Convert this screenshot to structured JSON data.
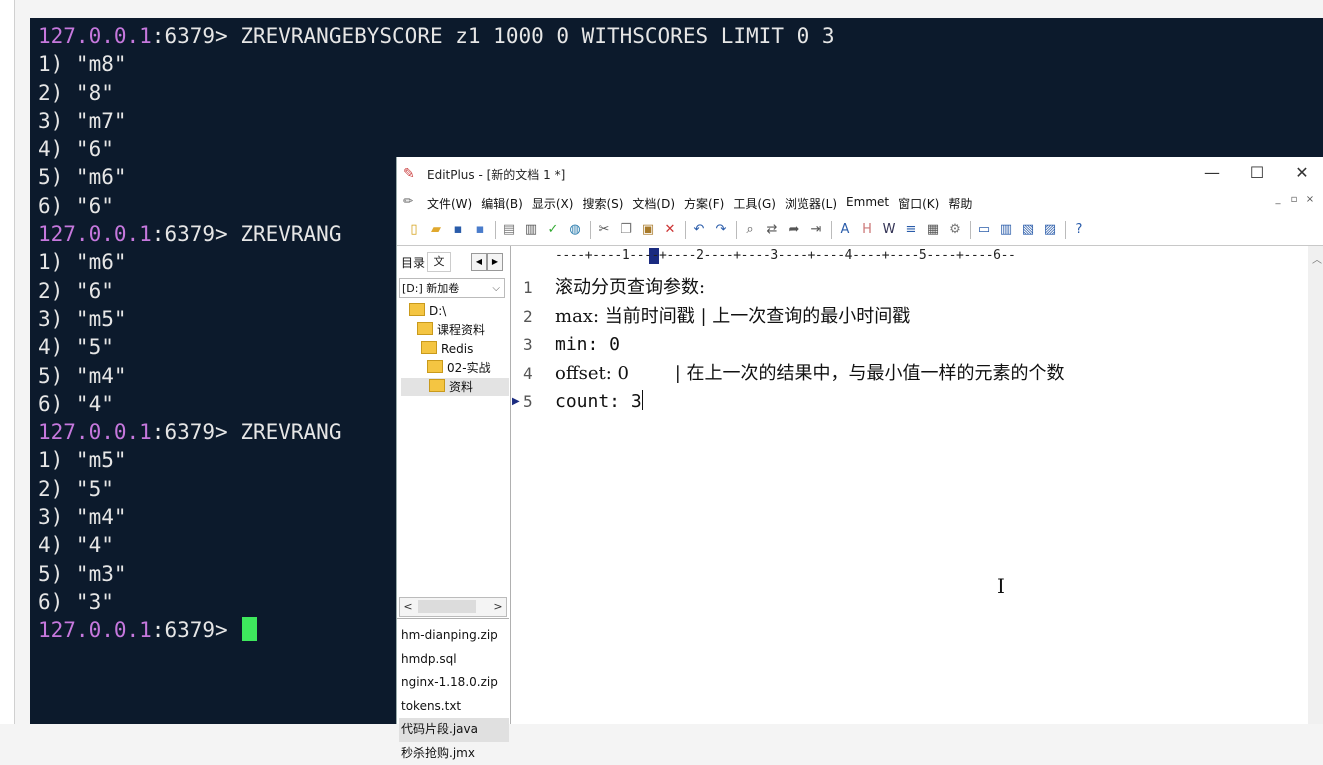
{
  "terminal": {
    "prompt_host": "127.0.0.1",
    "prompt_rest": ":6379> ",
    "lines": [
      {
        "kind": "cmd",
        "text": "ZREVRANGEBYSCORE z1 1000 0 WITHSCORES LIMIT 0 3"
      },
      {
        "kind": "out",
        "text": "1) \"m8\""
      },
      {
        "kind": "out",
        "text": "2) \"8\""
      },
      {
        "kind": "out",
        "text": "3) \"m7\""
      },
      {
        "kind": "out",
        "text": "4) \"6\""
      },
      {
        "kind": "out",
        "text": "5) \"m6\""
      },
      {
        "kind": "out",
        "text": "6) \"6\""
      },
      {
        "kind": "cmd",
        "text": "ZREVRANG"
      },
      {
        "kind": "out",
        "text": "1) \"m6\""
      },
      {
        "kind": "out",
        "text": "2) \"6\""
      },
      {
        "kind": "out",
        "text": "3) \"m5\""
      },
      {
        "kind": "out",
        "text": "4) \"5\""
      },
      {
        "kind": "out",
        "text": "5) \"m4\""
      },
      {
        "kind": "out",
        "text": "6) \"4\""
      },
      {
        "kind": "cmd",
        "text": "ZREVRANG"
      },
      {
        "kind": "out",
        "text": "1) \"m5\""
      },
      {
        "kind": "out",
        "text": "2) \"5\""
      },
      {
        "kind": "out",
        "text": "3) \"m4\""
      },
      {
        "kind": "out",
        "text": "4) \"4\""
      },
      {
        "kind": "out",
        "text": "5) \"m3\""
      },
      {
        "kind": "out",
        "text": "6) \"3\""
      },
      {
        "kind": "prompt",
        "text": ""
      }
    ]
  },
  "editplus": {
    "title": "EditPlus - [新的文档 1 *]",
    "window_buttons": {
      "minimize": "—",
      "maximize": "☐",
      "close": "✕"
    },
    "menu": [
      "文件(W)",
      "编辑(B)",
      "显示(X)",
      "搜索(S)",
      "文档(D)",
      "方案(F)",
      "工具(G)",
      "浏览器(L)",
      "Emmet",
      "窗口(K)",
      "帮助"
    ],
    "mdi_buttons": [
      "_",
      "▫",
      "×"
    ],
    "toolbar_icons": [
      "new-file-icon",
      "open-folder-icon",
      "save-icon",
      "save-all-icon",
      "sep",
      "print-preview-icon",
      "print-icon",
      "spell-check-icon",
      "browser-icon",
      "sep",
      "cut-icon",
      "copy-icon",
      "paste-icon",
      "delete-icon",
      "sep",
      "undo-icon",
      "redo-icon",
      "sep",
      "find-icon",
      "replace-icon",
      "goto-icon",
      "indent-icon",
      "sep",
      "font-icon",
      "hex-icon",
      "word-wrap-icon",
      "line-icon",
      "column-icon",
      "settings-icon",
      "sep",
      "window-icon",
      "split-icon",
      "cliptext-icon",
      "directory-icon",
      "sep",
      "help-icon"
    ],
    "sidebar": {
      "tab_label": "目录",
      "tab_second": "文",
      "drive": "[D:] 新加卷",
      "folders": [
        "D:\\",
        "课程资料",
        "Redis",
        "02-实战",
        "资料"
      ],
      "files": [
        "hm-dianping.zip",
        "hmdp.sql",
        "nginx-1.18.0.zip",
        "tokens.txt",
        "代码片段.java",
        "秒杀抢购.jmx"
      ],
      "selected_file": "代码片段.java"
    },
    "ruler": "----+----1----+----2----+----3----+----4----+----5----+----6--",
    "editor_lines": [
      {
        "n": "1",
        "text": "滚动分页查询参数:"
      },
      {
        "n": "2",
        "text": "max: 当前时间戳 | 上一次查询的最小时间戳"
      },
      {
        "n": "3",
        "text": "min: 0"
      },
      {
        "n": "4",
        "text": "offset: 0        | 在上一次的结果中，与最小值一样的元素的个数"
      },
      {
        "n": "5",
        "text": "count: 3"
      }
    ],
    "current_line": "5"
  }
}
